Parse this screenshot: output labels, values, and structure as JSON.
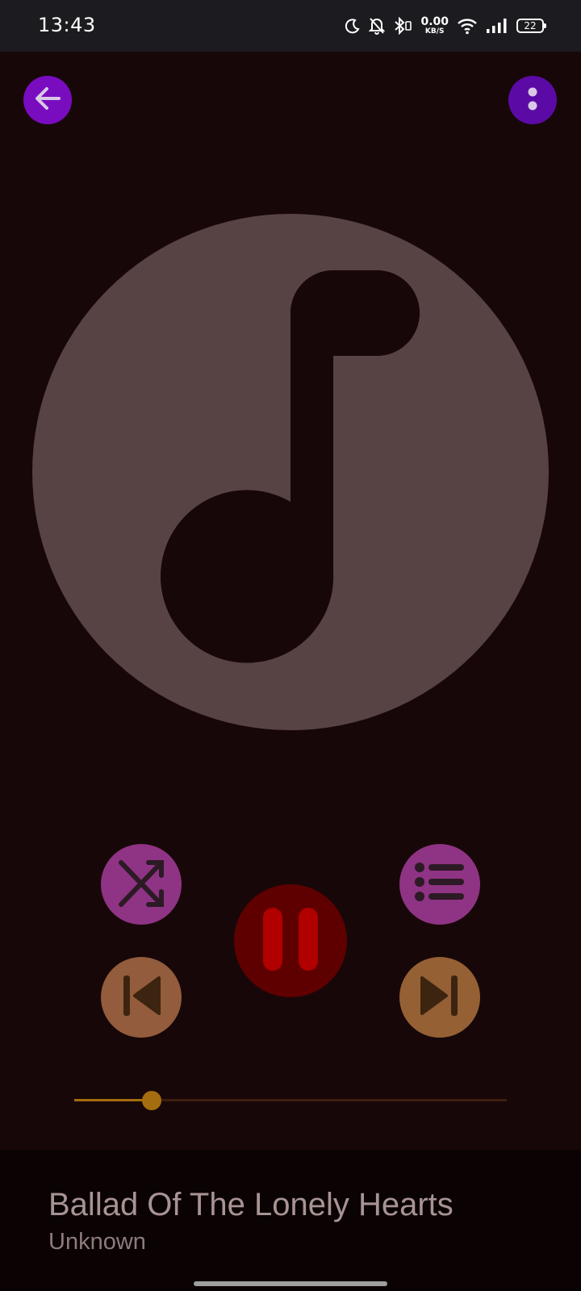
{
  "status_bar": {
    "time": "13:43",
    "net_speed_value": "0.00",
    "net_speed_unit": "KB/S",
    "battery": "22",
    "icons": [
      "moon-icon",
      "bell-off-icon",
      "bluetooth-icon",
      "wifi-icon",
      "signal-icon",
      "battery-icon"
    ]
  },
  "header": {
    "back_icon": "arrow-left-icon",
    "more_icon": "more-vertical-icon",
    "back_color": "#7a0cc0",
    "more_color": "#5c0aa5"
  },
  "album_art": {
    "icon": "music-note-icon",
    "color": "#574244"
  },
  "controls": {
    "shuffle_icon": "shuffle-icon",
    "queue_icon": "queue-list-icon",
    "play_pause_icon": "pause-icon",
    "previous_icon": "skip-previous-icon",
    "next_icon": "skip-next-icon",
    "shuffle_color": "#8f3384",
    "pause_color": "#5f0000",
    "previous_color": "#935c3c",
    "next_color": "#946034"
  },
  "seek_bar": {
    "progress": 0.18,
    "accent_color": "#a46d0f"
  },
  "track": {
    "title": "Ballad Of The Lonely Hearts",
    "artist": "Unknown"
  }
}
